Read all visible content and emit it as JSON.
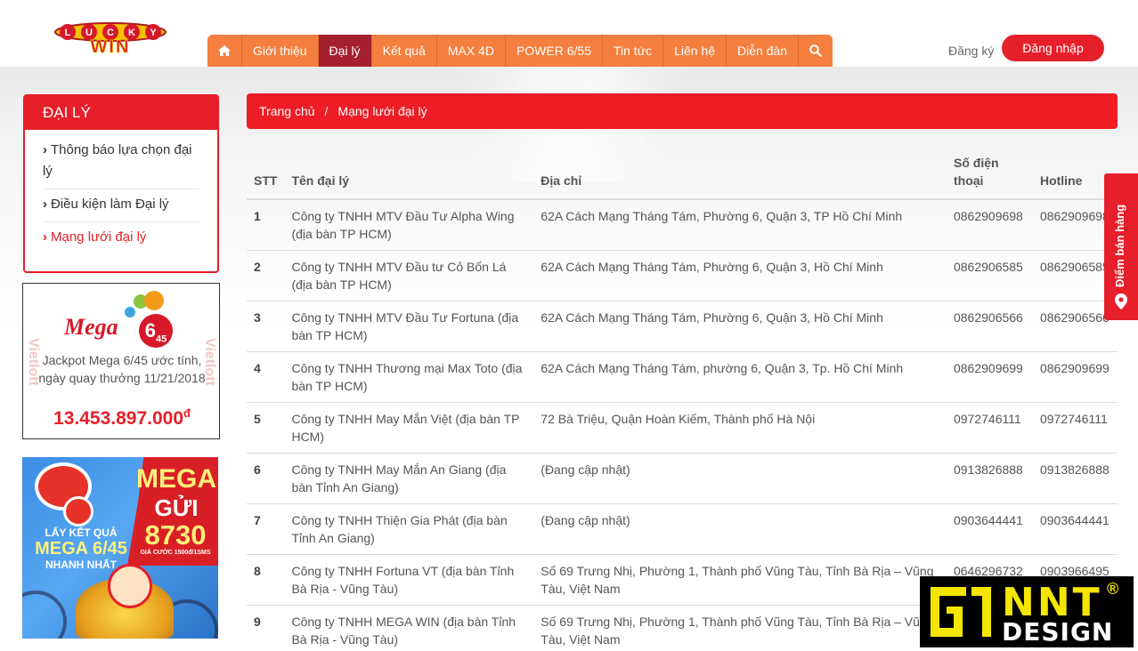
{
  "header": {
    "logo_top": "LUCKY",
    "logo_bottom": "WIN",
    "nav": [
      {
        "label": "Giới thiệu",
        "active": false
      },
      {
        "label": "Đại lý",
        "active": true
      },
      {
        "label": "Kết quả",
        "active": false
      },
      {
        "label": "MAX 4D",
        "active": false
      },
      {
        "label": "POWER 6/55",
        "active": false
      },
      {
        "label": "Tin tức",
        "active": false
      },
      {
        "label": "Liên hệ",
        "active": false
      },
      {
        "label": "Diễn đàn",
        "active": false
      }
    ],
    "home_icon": "home-icon",
    "search_icon": "search-icon",
    "register_label": "Đăng ký",
    "login_label": "Đăng nhập"
  },
  "sidebar": {
    "title": "ĐẠI LÝ",
    "items": [
      {
        "label": "Thông báo lựa chọn đại lý",
        "active": false
      },
      {
        "label": "Điều kiện làm Đại lý",
        "active": false
      },
      {
        "label": "Mạng lưới đại lý",
        "active": true
      }
    ]
  },
  "mega_widget": {
    "brand_side": "Vietlott",
    "logo_text": "Mega",
    "logo_number": "6",
    "logo_sub": "45",
    "description": "Jackpot Mega 6/45 ước tính, ngày quay thưởng 11/21/2018",
    "amount": "13.453.897.000",
    "currency": "đ"
  },
  "sms_banner": {
    "mega": "MEGA",
    "gui": "GỬI",
    "number": "8730",
    "fee": "GIÁ CƯỚC 1500đ/1SMS",
    "lay": "LẤY KẾT QUẢ",
    "product": "MEGA 6/45",
    "fast": "NHANH NHẤT"
  },
  "breadcrumb": {
    "home": "Trang chủ",
    "separator": "/",
    "current": "Mạng lưới đại lý"
  },
  "table": {
    "headers": {
      "stt": "STT",
      "name": "Tên đại lý",
      "address": "Địa chỉ",
      "phone": "Số điện thoại",
      "hotline": "Hotline"
    },
    "rows": [
      {
        "stt": "1",
        "name": "Công ty TNHH MTV Đầu Tư Alpha Wing (địa bàn TP HCM)",
        "address": "62A Cách Mạng Tháng Tám, Phường 6, Quận 3, TP Hồ Chí Minh",
        "phone": "0862909698",
        "hotline": "0862909698"
      },
      {
        "stt": "2",
        "name": "Công ty TNHH MTV Đầu tư Cỏ Bốn Lá (địa bàn TP HCM)",
        "address": "62A Cách Mạng Tháng Tám, Phường 6, Quận 3, Hồ Chí Minh",
        "phone": "0862906585",
        "hotline": "0862906585"
      },
      {
        "stt": "3",
        "name": "Công ty TNHH MTV Đầu Tư Fortuna (địa bàn TP HCM)",
        "address": "62A Cách Mạng Tháng Tám, Phường 6, Quận 3, Hồ Chí Minh",
        "phone": "0862906566",
        "hotline": "0862906566"
      },
      {
        "stt": "4",
        "name": "Công ty TNHH Thương mại Max Toto (địa bàn TP HCM)",
        "address": "62A Cách Mạng Tháng Tám, phường 6, Quận 3, Tp. Hồ Chí Minh",
        "phone": "0862909699",
        "hotline": "0862909699"
      },
      {
        "stt": "5",
        "name": "Công ty TNHH May Mắn Việt (địa bàn TP HCM)",
        "address": "72 Bà Triệu, Quận Hoàn Kiếm, Thành phố Hà Nội",
        "phone": "0972746111",
        "hotline": "0972746111"
      },
      {
        "stt": "6",
        "name": "Công ty TNHH May Mắn An Giang (địa bàn Tỉnh An Giang)",
        "address": "(Đang cập nhật)",
        "phone": "0913826888",
        "hotline": "0913826888"
      },
      {
        "stt": "7",
        "name": "Công ty TNHH Thiện Gia Phát (địa bàn Tỉnh An Giang)",
        "address": "(Đang cập nhật)",
        "phone": "0903644441",
        "hotline": "0903644441"
      },
      {
        "stt": "8",
        "name": "Công ty TNHH Fortuna VT (địa bàn Tỉnh Bà Rịa - Vũng Tàu)",
        "address": "Số 69 Trưng Nhị, Phường 1, Thành phố Vũng Tàu, Tỉnh Bà Rịa – Vũng Tàu, Việt Nam",
        "phone": "0646296732",
        "hotline": "0903966495"
      },
      {
        "stt": "9",
        "name": "Công ty TNHH MEGA WIN (địa bàn Tỉnh Bà Rịa - Vũng Tàu)",
        "address": "Số 69 Trưng Nhị, Phường 1, Thành phố Vũng Tàu, Tỉnh Bà Rịa – Vũng Tàu, Việt Nam",
        "phone": "",
        "hotline": ""
      }
    ]
  },
  "float_tab": {
    "label": "Điểm bán hàng",
    "icon": "map-marker-icon"
  },
  "watermark": {
    "brand": "NNT",
    "sub": "DESIGN",
    "reg": "®"
  },
  "colors": {
    "primary_red": "#e61f2b",
    "nav_orange": "#f47f3e",
    "nav_active": "#a5202e"
  }
}
